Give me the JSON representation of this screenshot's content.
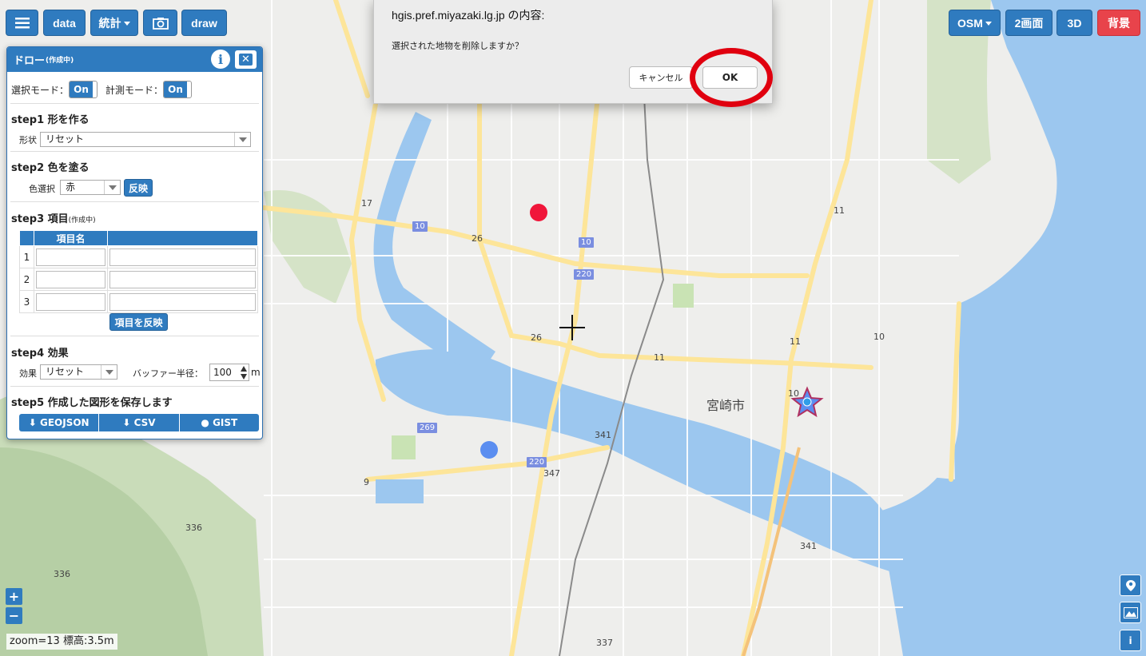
{
  "toolbar": {
    "menu_icon": "hamburger-icon",
    "data_label": "data",
    "stats_label": "統計",
    "camera_icon": "camera-icon",
    "draw_label": "draw",
    "osm_label": "OSM",
    "split_label": "2画面",
    "three_d_label": "3D",
    "background_label": "背景",
    "accent": "#2f7bbf",
    "danger": "#e8434b"
  },
  "panel": {
    "title": "ドロー",
    "title_note": "(作成中)",
    "select_mode_label": "選択モード：",
    "select_mode_value": "On",
    "measure_mode_label": "計測モード：",
    "measure_mode_value": "On",
    "step1": {
      "title": "step1 形を作る",
      "shape_label": "形状",
      "shape_value": "リセット"
    },
    "step2": {
      "title": "step2 色を塗る",
      "color_label": "色選択",
      "color_value": "赤",
      "apply_label": "反映"
    },
    "step3": {
      "title": "step3 項目",
      "title_note": "(作成中)",
      "column_header": "項目名",
      "row_numbers": [
        "1",
        "2",
        "3"
      ],
      "apply_label": "項目を反映"
    },
    "step4": {
      "title": "step4 効果",
      "effect_label": "効果",
      "effect_value": "リセット",
      "buffer_label": "バッファー半径：",
      "buffer_value": "100",
      "buffer_unit": "m"
    },
    "step5": {
      "title": "step5 作成した図形を保存します",
      "geojson_label": "GEOJSON",
      "csv_label": "CSV",
      "gist_label": "GIST"
    }
  },
  "dialog": {
    "title": "hgis.pref.miyazaki.lg.jp の内容:",
    "message": "選択された地物を削除しますか？",
    "cancel_label": "キャンセル",
    "ok_label": "OK",
    "highlight_color": "#e0000f"
  },
  "map": {
    "city_label": "宮崎市",
    "road_numbers": [
      "17",
      "26",
      "10",
      "10",
      "220",
      "26",
      "11",
      "11",
      "11",
      "10",
      "10",
      "269",
      "220",
      "341",
      "347",
      "9",
      "336",
      "336",
      "341",
      "337"
    ],
    "zoom_status": "zoom=13 標高:3.5m",
    "zoom_in": "+",
    "zoom_out": "−",
    "markers": {
      "red_point": "#f0163a",
      "blue_point": "#5b8ef0",
      "star": "#b03060"
    }
  }
}
